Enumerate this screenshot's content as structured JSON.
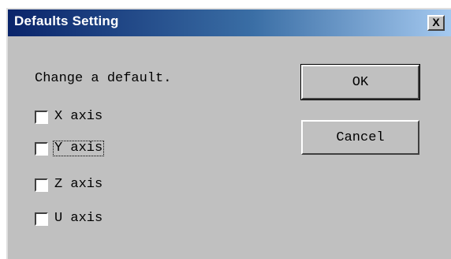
{
  "dialog": {
    "title": "Defaults Setting",
    "close_label": "X",
    "prompt": "Change a default.",
    "checkboxes": [
      {
        "label": "X axis",
        "checked": false
      },
      {
        "label": "Y axis",
        "checked": false,
        "focused": true
      },
      {
        "label": "Z axis",
        "checked": false
      },
      {
        "label": "U axis",
        "checked": false
      }
    ],
    "ok_label": "OK",
    "cancel_label": "Cancel"
  },
  "colors": {
    "window_bg": "#c0c0c0",
    "titlebar_start": "#0a246a",
    "titlebar_end": "#a6caf0",
    "title_text": "#ffffff"
  },
  "icons": {
    "close": "close-icon"
  }
}
